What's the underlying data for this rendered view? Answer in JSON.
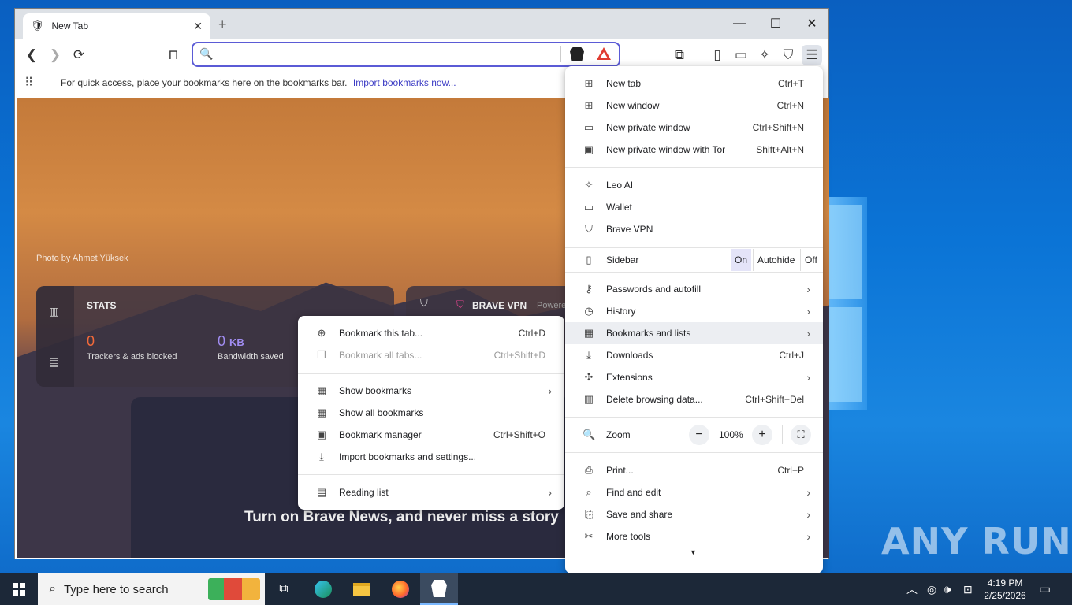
{
  "window": {
    "tab_title": "New Tab",
    "new_tab_glyph": "+",
    "minimize_glyph": "—",
    "maximize_glyph": "☐",
    "close_glyph": "✕"
  },
  "toolbar": {
    "omnibox_value": "",
    "icons": [
      "back-icon",
      "forward-icon",
      "reload-icon",
      "bookmark-icon",
      "brave-shields-icon",
      "brave-rewards-icon",
      "screenshot-icon",
      "sidebar-icon",
      "wallet-icon",
      "leo-icon",
      "vpn-icon",
      "menu-icon"
    ]
  },
  "bookmarks_bar": {
    "message": "For quick access, place your bookmarks here on the bookmarks bar.",
    "import_link": "Import bookmarks now..."
  },
  "new_tab_page": {
    "photo_credit": "Photo by Ahmet Yüksek",
    "stats_title": "STATS",
    "trackers_value": "0",
    "trackers_label": "Trackers & ads blocked",
    "bandwidth_value": "0",
    "bandwidth_unit": "KB",
    "bandwidth_label": "Bandwidth saved",
    "vpn_title": "BRAVE VPN",
    "vpn_powered": "Powere",
    "news_prompt": "Turn on Brave News, and never miss a story"
  },
  "main_menu": {
    "items": [
      {
        "label": "New tab",
        "shortcut": "Ctrl+T",
        "icon": "new-tab-icon"
      },
      {
        "label": "New window",
        "shortcut": "Ctrl+N",
        "icon": "new-window-icon"
      },
      {
        "label": "New private window",
        "shortcut": "Ctrl+Shift+N",
        "icon": "private-window-icon"
      },
      {
        "label": "New private window with Tor",
        "shortcut": "Shift+Alt+N",
        "icon": "tor-window-icon"
      },
      {
        "label": "Leo AI",
        "icon": "leo-icon"
      },
      {
        "label": "Wallet",
        "icon": "wallet-icon"
      },
      {
        "label": "Brave VPN",
        "icon": "vpn-icon"
      },
      {
        "label": "Sidebar",
        "icon": "sidebar-icon"
      },
      {
        "label": "Passwords and autofill",
        "icon": "key-icon"
      },
      {
        "label": "History",
        "icon": "history-icon"
      },
      {
        "label": "Bookmarks and lists",
        "icon": "bookmarks-icon"
      },
      {
        "label": "Downloads",
        "shortcut": "Ctrl+J",
        "icon": "download-icon"
      },
      {
        "label": "Extensions",
        "icon": "extensions-icon"
      },
      {
        "label": "Delete browsing data...",
        "shortcut": "Ctrl+Shift+Del",
        "icon": "trash-icon"
      },
      {
        "label": "Zoom",
        "icon": "zoom-icon"
      },
      {
        "label": "Print...",
        "shortcut": "Ctrl+P",
        "icon": "print-icon"
      },
      {
        "label": "Find and edit",
        "icon": "find-icon"
      },
      {
        "label": "Save and share",
        "icon": "save-icon"
      },
      {
        "label": "More tools",
        "icon": "tools-icon"
      }
    ],
    "sidebar_options": {
      "on": "On",
      "autohide": "Autohide",
      "off": "Off",
      "selected": "On"
    },
    "zoom": {
      "minus": "−",
      "value": "100%",
      "plus": "+"
    }
  },
  "bookmarks_submenu": {
    "items": [
      {
        "label": "Bookmark this tab...",
        "shortcut": "Ctrl+D",
        "icon": "bookmark-add-icon"
      },
      {
        "label": "Bookmark all tabs...",
        "shortcut": "Ctrl+Shift+D",
        "icon": "bookmark-all-icon"
      },
      {
        "label": "Show bookmarks",
        "icon": "show-bookmarks-icon"
      },
      {
        "label": "Show all bookmarks",
        "icon": "show-all-bookmarks-icon"
      },
      {
        "label": "Bookmark manager",
        "shortcut": "Ctrl+Shift+O",
        "icon": "bookmark-manager-icon"
      },
      {
        "label": "Import bookmarks and settings...",
        "icon": "import-icon"
      },
      {
        "label": "Reading list",
        "icon": "reading-list-icon"
      }
    ]
  },
  "desktop": {
    "watermark": "ANY RUN"
  },
  "taskbar": {
    "search_placeholder": "Type here to search",
    "time": "4:19 PM",
    "date": "2/25/2026"
  },
  "colors": {
    "accent": "#5b5bd6",
    "stat_orange": "#f36a3a",
    "stat_purple": "#a08cf0",
    "vpn_pink": "#e5458f"
  }
}
